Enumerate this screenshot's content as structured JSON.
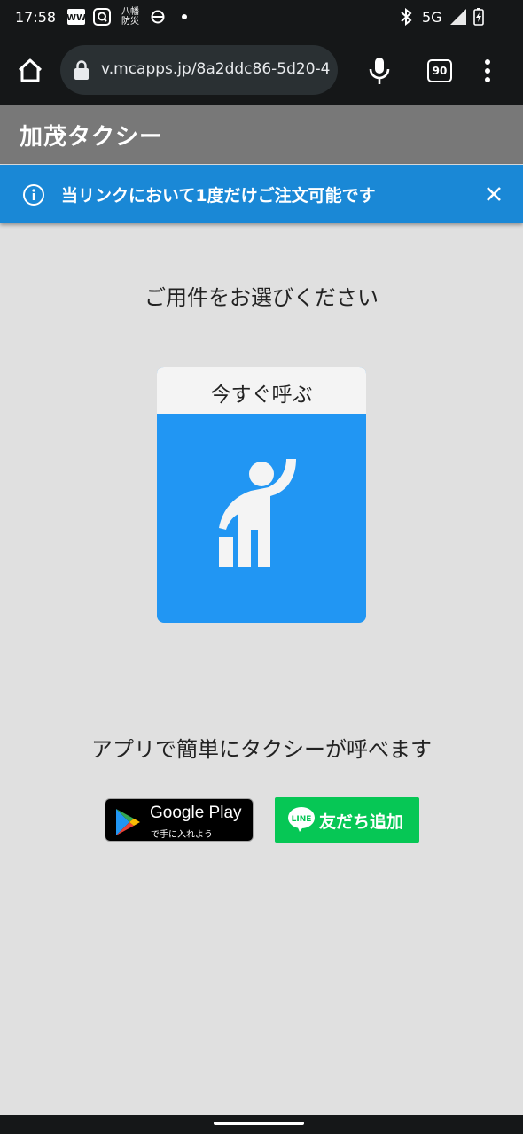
{
  "status_bar": {
    "time": "17:58",
    "notification_icons": [
      "ww-app-icon",
      "search-app-icon",
      "yawata-bousai-icon",
      "sync-icon",
      "dot-icon"
    ],
    "yawata_line1": "八幡",
    "yawata_line2": "防災",
    "network": "5G",
    "icons": [
      "bluetooth-icon",
      "signal-icon",
      "battery-charging-icon"
    ]
  },
  "browser": {
    "url": "v.mcapps.jp/8a2ddc86-5d20-4",
    "tab_count": "90",
    "icons": [
      "home-icon",
      "lock-icon",
      "mic-icon",
      "tabs-icon",
      "more-vert-icon"
    ]
  },
  "app": {
    "title": "加茂タクシー"
  },
  "notice": {
    "text": "当リンクにおいて1度だけご注文可能です",
    "icons": [
      "info-icon",
      "close-icon"
    ]
  },
  "main": {
    "prompt": "ご用件をお選びください",
    "call_now": {
      "label": "今すぐ呼ぶ",
      "icon": "hail-taxi-icon"
    },
    "app_promo": "アプリで簡単にタクシーが呼べます",
    "google_play": {
      "name": "Google Play",
      "sub": "で手に入れよう"
    },
    "line": {
      "logo_text": "LINE",
      "label": "友だち追加"
    }
  },
  "colors": {
    "header_bg": "#787878",
    "notice_bg": "#1a88d6",
    "card_blue": "#2196f3",
    "line_green": "#06c755",
    "page_bg": "#e0e0e0"
  }
}
